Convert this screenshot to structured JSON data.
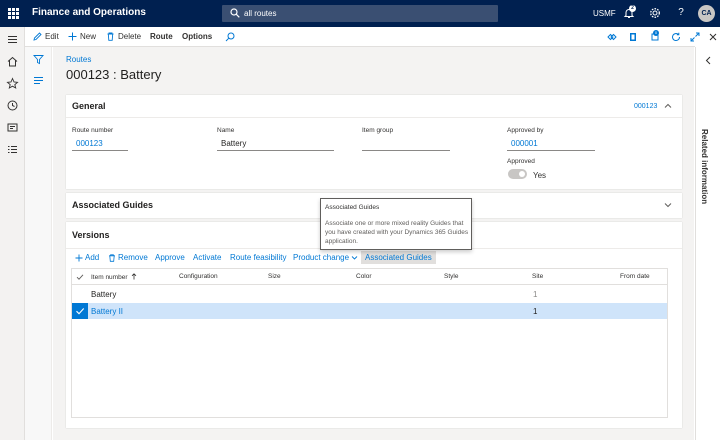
{
  "topbar": {
    "app_title": "Finance and Operations",
    "search_value": "all routes",
    "company": "USMF",
    "notification_count": "2",
    "avatar_initials": "CA"
  },
  "actionpane": {
    "edit": "Edit",
    "new": "New",
    "delete": "Delete",
    "route": "Route",
    "options": "Options",
    "attachments_count": "0"
  },
  "breadcrumb": "Routes",
  "page_title": "000123 : Battery",
  "general": {
    "title": "General",
    "summary": "000123",
    "route_number_label": "Route number",
    "route_number_value": "000123",
    "name_label": "Name",
    "name_value": "Battery",
    "item_group_label": "Item group",
    "item_group_value": "",
    "approved_by_label": "Approved by",
    "approved_by_value": "000001",
    "approved_label": "Approved",
    "approved_value": "Yes"
  },
  "associated_guides": {
    "title": "Associated Guides"
  },
  "tooltip": {
    "title": "Associated Guides",
    "body": "Associate one or more mixed reality Guides that you have created with your Dynamics 365 Guides application."
  },
  "versions": {
    "title": "Versions",
    "toolbar": {
      "add": "Add",
      "remove": "Remove",
      "approve": "Approve",
      "activate": "Activate",
      "route_feasibility": "Route feasibility",
      "product_change": "Product change",
      "associated_guides": "Associated Guides"
    },
    "columns": {
      "item_number": "Item number",
      "configuration": "Configuration",
      "size": "Size",
      "color": "Color",
      "style": "Style",
      "site": "Site",
      "from_date": "From date"
    },
    "rows": [
      {
        "item_number": "Battery",
        "configuration": "",
        "size": "",
        "color": "",
        "style": "",
        "site": "1",
        "from_date": ""
      },
      {
        "item_number": "Battery II",
        "configuration": "",
        "size": "",
        "color": "",
        "style": "",
        "site": "1",
        "from_date": ""
      }
    ]
  },
  "related_information": "Related information",
  "colors": {
    "nav": "#002050",
    "accent": "#0078d4",
    "selected_row": "#cfe4fa"
  }
}
